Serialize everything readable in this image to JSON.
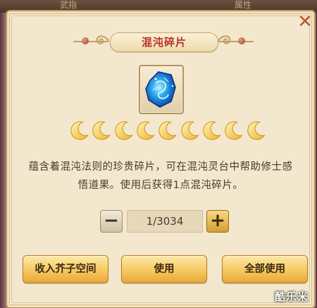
{
  "background": {
    "tabs": [
      "武指",
      "属性"
    ]
  },
  "dialog": {
    "title": "混沌碎片",
    "item_icon": "chaos-fragment-icon",
    "rating": {
      "value": 9,
      "max": 9,
      "icon": "crescent-moon-icon",
      "color": "#f0b532"
    },
    "description": "蕴含着混沌法则的珍贵碎片，可在混沌灵台中帮助修士感悟道果。使用后获得1点混沌碎片。",
    "quantity": {
      "minus_label": "−",
      "value": "1/3034",
      "plus_label": "+"
    },
    "buttons": {
      "store": "收入芥子空间",
      "use": "使用",
      "use_all": "全部使用"
    },
    "close_label": "✕"
  },
  "colors": {
    "title_red": "#b7332a",
    "close_orange": "#c4552d",
    "panel_bg": "#f3e8cd",
    "button_gold": "#f6c861"
  },
  "watermark": "酷乐米"
}
